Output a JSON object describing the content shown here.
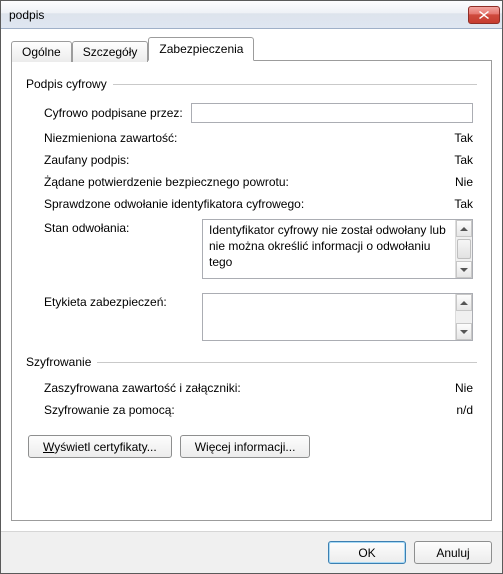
{
  "window": {
    "title": "podpis"
  },
  "tabs": {
    "general": "Ogólne",
    "details": "Szczegóły",
    "security": "Zabezpieczenia"
  },
  "signature": {
    "group_label": "Podpis cyfrowy",
    "signed_by_label": "Cyfrowo podpisane przez:",
    "signed_by_value": "",
    "unchanged_label": "Niezmieniona zawartość:",
    "unchanged_value": "Tak",
    "trusted_label": "Zaufany podpis:",
    "trusted_value": "Tak",
    "return_label": "Żądane potwierdzenie bezpiecznego powrotu:",
    "return_value": "Nie",
    "revocation_checked_label": "Sprawdzone odwołanie identyfikatora cyfrowego:",
    "revocation_checked_value": "Tak",
    "revocation_status_label": "Stan odwołania:",
    "revocation_status_text": "Identyfikator cyfrowy nie został odwołany lub nie można określić informacji o odwołaniu tego",
    "security_label_label": "Etykieta zabezpieczeń:",
    "security_label_text": ""
  },
  "encryption": {
    "group_label": "Szyfrowanie",
    "encrypted_label": "Zaszyfrowana zawartość i załączniki:",
    "encrypted_value": "Nie",
    "using_label": "Szyfrowanie za pomocą:",
    "using_value": "n/d"
  },
  "buttons": {
    "view_cert_pre": "W",
    "view_cert_rest": "yświetl certyfikaty...",
    "more_info_pre": "Więce",
    "more_info_u": "j",
    "more_info_rest": " informacji...",
    "ok": "OK",
    "cancel": "Anuluj"
  }
}
